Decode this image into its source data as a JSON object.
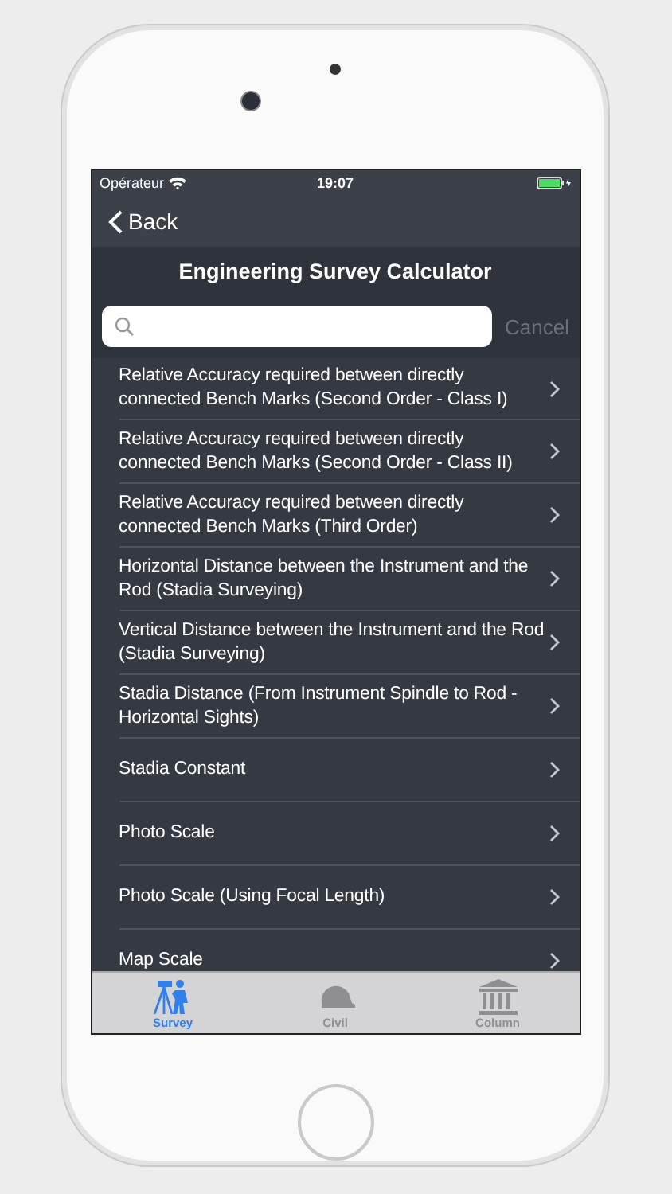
{
  "status_bar": {
    "carrier": "Opérateur",
    "time": "19:07"
  },
  "nav": {
    "back": "Back",
    "title": "Engineering Survey Calculator"
  },
  "search": {
    "cancel": "Cancel"
  },
  "rows": [
    {
      "title": "Relative Accuracy required between directly connected Bench Marks (Second Order - Class I)"
    },
    {
      "title": "Relative Accuracy required between directly connected Bench Marks (Second Order - Class II)"
    },
    {
      "title": "Relative Accuracy required between directly connected Bench Marks (Third Order)"
    },
    {
      "title": "Horizontal Distance between the Instrument and the Rod (Stadia Surveying)"
    },
    {
      "title": "Vertical Distance between the Instrument and the Rod (Stadia Surveying)"
    },
    {
      "title": "Stadia Distance (From Instrument Spindle to Rod - Horizontal Sights)"
    },
    {
      "title": "Stadia Constant"
    },
    {
      "title": "Photo Scale"
    },
    {
      "title": "Photo Scale (Using Focal Length)"
    },
    {
      "title": "Map Scale"
    }
  ],
  "tabs": [
    {
      "label": "Survey",
      "kind": "surveyor",
      "selected": true
    },
    {
      "label": "Civil",
      "kind": "helmet",
      "selected": false
    },
    {
      "label": "Column",
      "kind": "building",
      "selected": false
    }
  ]
}
